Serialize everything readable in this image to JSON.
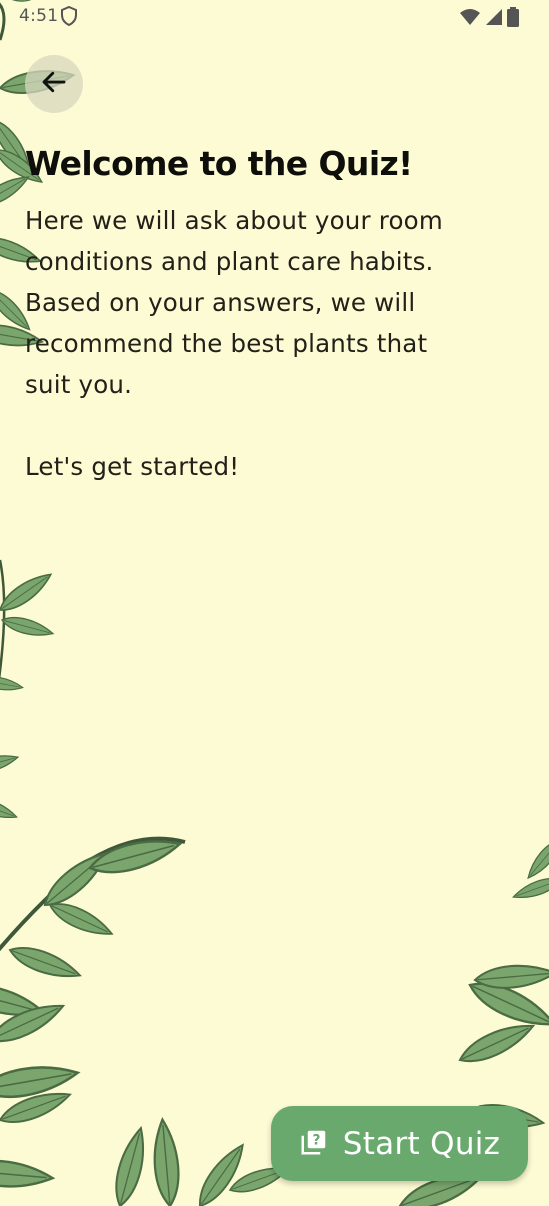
{
  "status_bar": {
    "time": "4:51",
    "icons": [
      "shield-icon",
      "wifi-icon",
      "signal-icon",
      "battery-icon"
    ]
  },
  "header": {
    "back_icon": "arrow-left-icon"
  },
  "main": {
    "title": "Welcome to the Quiz!",
    "intro": "Here we will ask about your room\nconditions and plant care habits.\nBased on your answers, we will\nrecommend the best plants that\nsuit you.",
    "cta": "Let's get started!"
  },
  "fab": {
    "label": "Start Quiz",
    "icon": "quiz-icon"
  },
  "colors": {
    "background": "#fdfbd4",
    "fab": "#6aa96d",
    "leaf": "#6f9e64",
    "leaf_dark": "#3f6b3c"
  }
}
